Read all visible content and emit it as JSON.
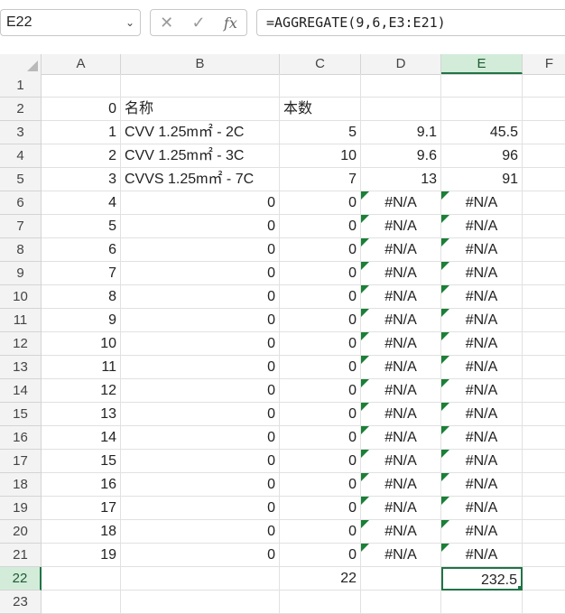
{
  "formula_bar": {
    "name_box": "E22",
    "cancel_icon": "✕",
    "enter_icon": "✓",
    "fx_label": "fx",
    "formula": "=AGGREGATE(9,6,E3:E21)"
  },
  "columns": [
    "A",
    "B",
    "C",
    "D",
    "E",
    "F"
  ],
  "selected_column": "E",
  "selected_row": "22",
  "rows": [
    {
      "n": "1",
      "a": "",
      "b": "",
      "c": "",
      "d": "",
      "e": ""
    },
    {
      "n": "2",
      "a": "0",
      "b": "名称",
      "c": "本数",
      "d": "",
      "e": ""
    },
    {
      "n": "3",
      "a": "1",
      "b": "CVV 1.25m㎡ - 2C",
      "c": "5",
      "d": "9.1",
      "e": "45.5"
    },
    {
      "n": "4",
      "a": "2",
      "b": "CVV 1.25m㎡ - 3C",
      "c": "10",
      "d": "9.6",
      "e": "96"
    },
    {
      "n": "5",
      "a": "3",
      "b": "CVVS 1.25m㎡ - 7C",
      "c": "7",
      "d": "13",
      "e": "91"
    },
    {
      "n": "6",
      "a": "4",
      "b": "0",
      "c": "0",
      "d": "#N/A",
      "e": "#N/A"
    },
    {
      "n": "7",
      "a": "5",
      "b": "0",
      "c": "0",
      "d": "#N/A",
      "e": "#N/A"
    },
    {
      "n": "8",
      "a": "6",
      "b": "0",
      "c": "0",
      "d": "#N/A",
      "e": "#N/A"
    },
    {
      "n": "9",
      "a": "7",
      "b": "0",
      "c": "0",
      "d": "#N/A",
      "e": "#N/A"
    },
    {
      "n": "10",
      "a": "8",
      "b": "0",
      "c": "0",
      "d": "#N/A",
      "e": "#N/A"
    },
    {
      "n": "11",
      "a": "9",
      "b": "0",
      "c": "0",
      "d": "#N/A",
      "e": "#N/A"
    },
    {
      "n": "12",
      "a": "10",
      "b": "0",
      "c": "0",
      "d": "#N/A",
      "e": "#N/A"
    },
    {
      "n": "13",
      "a": "11",
      "b": "0",
      "c": "0",
      "d": "#N/A",
      "e": "#N/A"
    },
    {
      "n": "14",
      "a": "12",
      "b": "0",
      "c": "0",
      "d": "#N/A",
      "e": "#N/A"
    },
    {
      "n": "15",
      "a": "13",
      "b": "0",
      "c": "0",
      "d": "#N/A",
      "e": "#N/A"
    },
    {
      "n": "16",
      "a": "14",
      "b": "0",
      "c": "0",
      "d": "#N/A",
      "e": "#N/A"
    },
    {
      "n": "17",
      "a": "15",
      "b": "0",
      "c": "0",
      "d": "#N/A",
      "e": "#N/A"
    },
    {
      "n": "18",
      "a": "16",
      "b": "0",
      "c": "0",
      "d": "#N/A",
      "e": "#N/A"
    },
    {
      "n": "19",
      "a": "17",
      "b": "0",
      "c": "0",
      "d": "#N/A",
      "e": "#N/A"
    },
    {
      "n": "20",
      "a": "18",
      "b": "0",
      "c": "0",
      "d": "#N/A",
      "e": "#N/A"
    },
    {
      "n": "21",
      "a": "19",
      "b": "0",
      "c": "0",
      "d": "#N/A",
      "e": "#N/A"
    },
    {
      "n": "22",
      "a": "",
      "b": "",
      "c": "22",
      "d": "",
      "e": "232.5"
    },
    {
      "n": "23",
      "a": "",
      "b": "",
      "c": "",
      "d": "",
      "e": ""
    }
  ],
  "colors": {
    "accent": "#217346",
    "selected_header_bg": "#d2ecd9",
    "error_flag": "#1a7f37"
  }
}
